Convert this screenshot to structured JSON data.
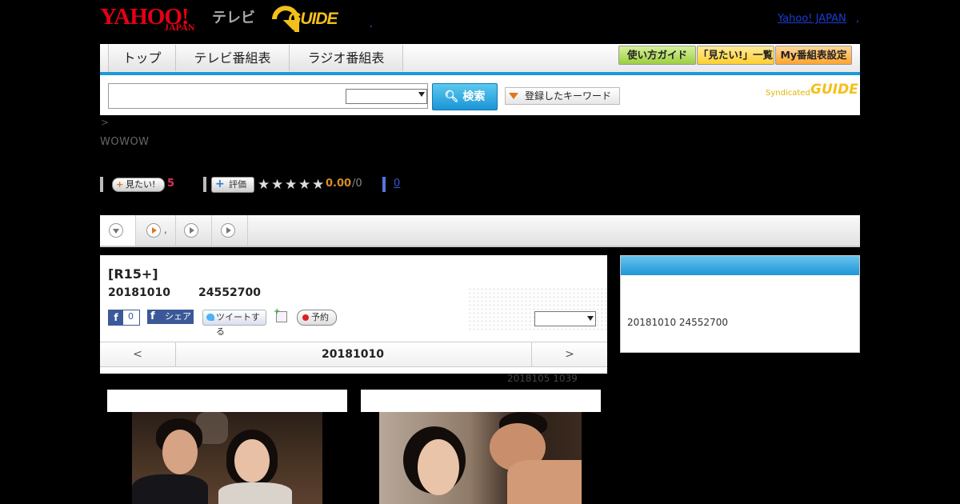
{
  "header": {
    "logo_yahoo": "YAHOO!",
    "logo_yahoo_sub": "JAPAN",
    "logo_tv": "テレビ",
    "logo_gguide": "GUIDE",
    "dot": ",",
    "yahoo_japan_link": "Yahoo! JAPAN",
    "comma": ","
  },
  "nav": {
    "tabs": [
      "トップ",
      "テレビ番組表",
      "ラジオ番組表"
    ],
    "buttons": [
      "使い方ガイド",
      "「見たい!」一覧",
      "My番組表設定"
    ],
    "button_colors": [
      "#b5e06a",
      "#ffd84a",
      "#ffb84a"
    ]
  },
  "search": {
    "input_value": "",
    "select_value": "",
    "search_button": "検索",
    "keyword_button": "登録したキーワード",
    "syndicated_label": "Syndicated",
    "syndicated_logo": "GUIDE"
  },
  "breadcrumb": " >",
  "channel": "WOWOW",
  "rating": {
    "want_button": "見たい!",
    "want_count": "5",
    "rate_button": "評価",
    "stars_filled": 0,
    "stars_total": 5,
    "score": "0.00",
    "count": "/0",
    "comment_count": "0"
  },
  "tabs": {
    "items": [
      "",
      ",",
      "",
      ""
    ]
  },
  "program": {
    "title": "[R15+]",
    "air_date": "20181010",
    "program_id": "24552700",
    "fb_like_count": "0",
    "fb_share": "シェア",
    "tweet": "ツイートする",
    "reserve": "予約",
    "select_value": ""
  },
  "date_nav": {
    "prev": "<",
    "date": "20181010",
    "next": ">"
  },
  "updated": "2018105  1039",
  "side": {
    "info": "20181010  24552700"
  },
  "colors": {
    "accent_blue": "#1a9ad9",
    "brand_red": "#e60012",
    "gguide_yellow": "#f3c01a"
  }
}
